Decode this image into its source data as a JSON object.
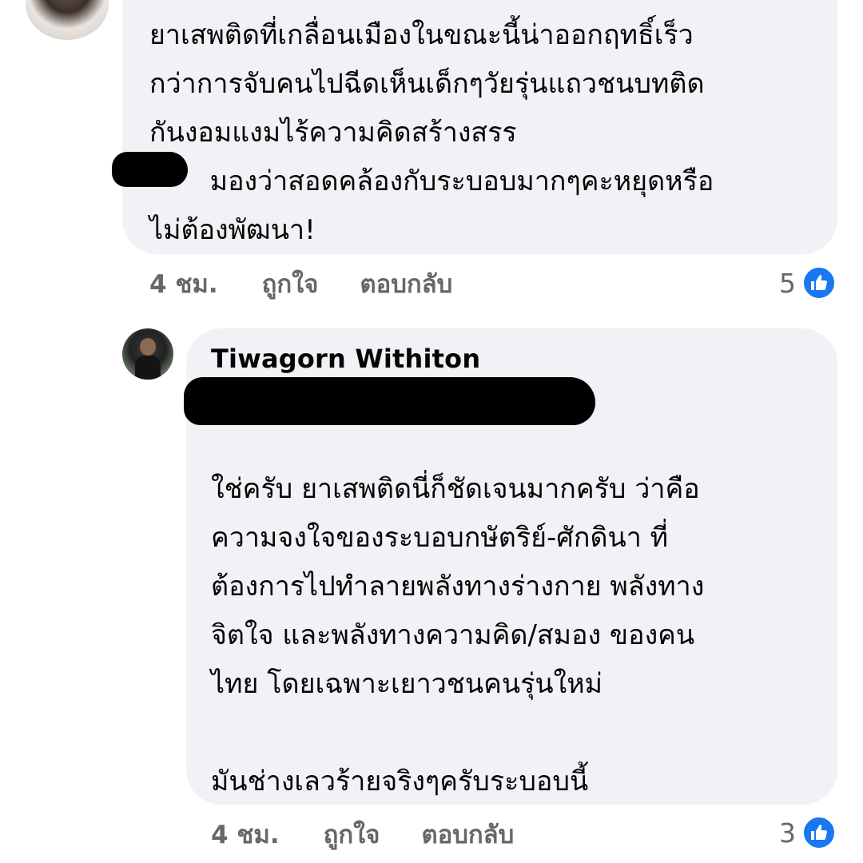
{
  "comments": [
    {
      "text": "ยาเสพติดที่เกลื่อนเมืองในขณะนี้น่าออกฤทธิ์เร็ว\nกว่าการจับคนไปฉีดเห็นเด็กๆวัยรุ่นแถวชนบทติด\nกันงอมแงมไร้ความคิดสร้างสรร\n       มองว่าสอดคล้องกับระบอบมากๆคะหยุดหรือ\nไม่ต้องพัฒนา!",
      "time": "4 ชม.",
      "like_label": "ถูกใจ",
      "reply_label": "ตอบกลับ",
      "reaction_count": "5"
    },
    {
      "author": "Tiwagorn Withiton",
      "text": "ใช่ครับ ยาเสพติดนี่ก็ชัดเจนมากครับ ว่าคือ\nความจงใจของระบอบกษัตริย์-ศักดินา ที่\nต้องการไปทำลายพลังทางร่างกาย พลังทาง\nจิตใจ และพลังทางความคิด/สมอง ของคน\nไทย โดยเฉพาะเยาวชนคนรุ่นใหม่\n\nมันช่างเลวร้ายจริงๆครับระบอบนี้",
      "time": "4 ชม.",
      "like_label": "ถูกใจ",
      "reply_label": "ตอบกลับ",
      "reaction_count": "3"
    }
  ],
  "colors": {
    "bubble": "#f0f2f5",
    "meta_text": "#65676b",
    "like_blue": "#1877f2",
    "body_text": "#050505"
  },
  "icons": {
    "reaction": "thumbs-up-icon"
  }
}
